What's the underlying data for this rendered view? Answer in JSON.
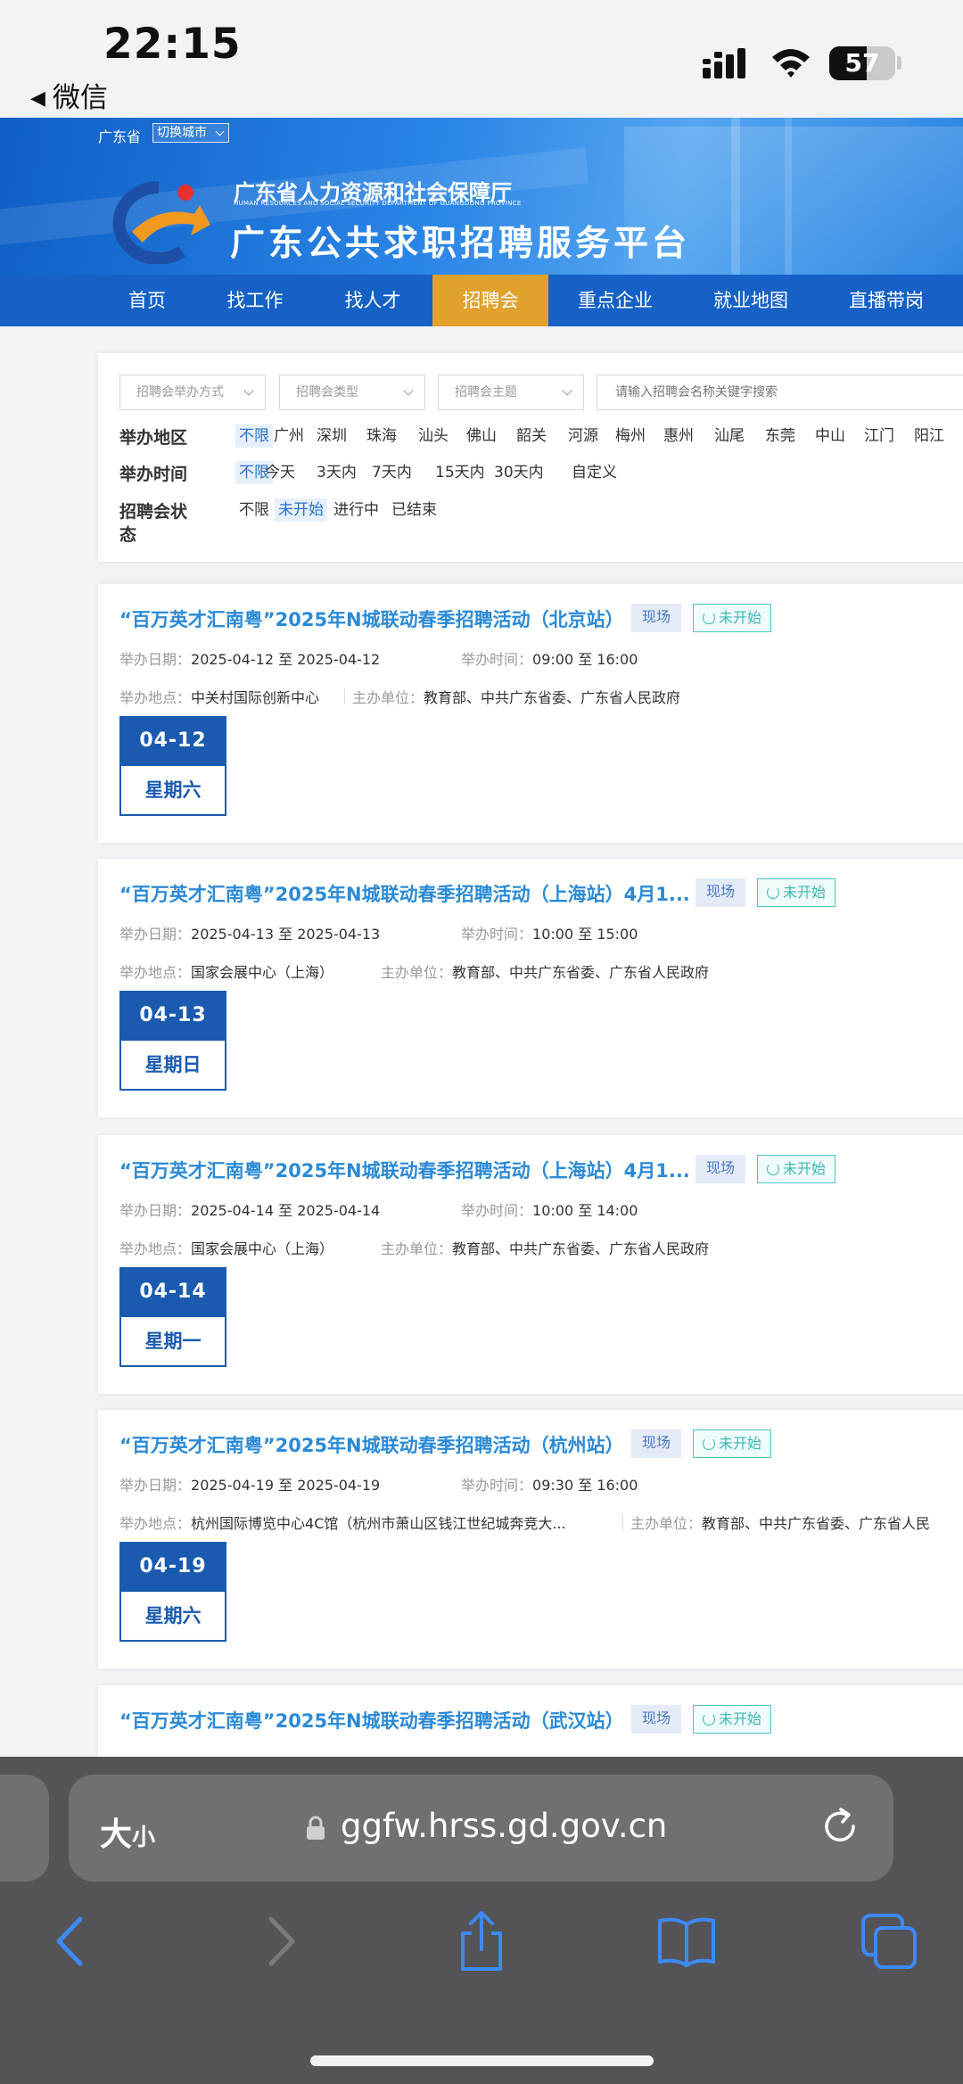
{
  "status_bar": {
    "time": "22:15",
    "back_label": "微信",
    "battery": "57",
    "battery_level": 0.57
  },
  "header": {
    "region": "广东省",
    "switch_city": "切换城市",
    "dept_cn": "广东省人力资源和社会保障厅",
    "dept_en": "HUMAN RESOURCES AND SOCIAL SECURITY DEPARTMENT OF GUANGDONG PROVINCE",
    "platform": "广东公共求职招聘服务平台"
  },
  "nav": [
    "首页",
    "找工作",
    "找人才",
    "招聘会",
    "重点企业",
    "就业地图",
    "直播带岗"
  ],
  "filters": {
    "selects": [
      "招聘会举办方式",
      "招聘会类型",
      "招聘会主题"
    ],
    "search_placeholder": "请输入招聘会名称关键字搜索",
    "area_label": "举办地区",
    "areas": [
      "不限",
      "广州",
      "深圳",
      "珠海",
      "汕头",
      "佛山",
      "韶关",
      "河源",
      "梅州",
      "惠州",
      "汕尾",
      "东莞",
      "中山",
      "江门",
      "阳江"
    ],
    "time_label": "举办时间",
    "times": [
      "不限",
      "今天",
      "3天内",
      "7天内",
      "15天内",
      "30天内",
      "自定义"
    ],
    "status_label_1": "招聘会状",
    "status_label_2": "态",
    "statuses": [
      "不限",
      "未开始",
      "进行中",
      "已结束"
    ]
  },
  "labels": {
    "date": "举办日期：",
    "time": "举办时间：",
    "place": "举办地点：",
    "host": "主办单位：",
    "to": "至"
  },
  "fairs": [
    {
      "title": "“百万英才汇南粤”2025年N城联动春季招聘活动（北京站）",
      "type": "现场",
      "status": "未开始",
      "start": "2025-04-12",
      "end": "2025-04-12",
      "time": "09:00 至 16:00",
      "place": "中关村国际创新中心",
      "host": "教育部、中共广东省委、广东省人民政府",
      "day": "04-12",
      "weekday": "星期六"
    },
    {
      "title": "“百万英才汇南粤”2025年N城联动春季招聘活动（上海站）4月1...",
      "type": "现场",
      "status": "未开始",
      "start": "2025-04-13",
      "end": "2025-04-13",
      "time": "10:00 至 15:00",
      "place": "国家会展中心（上海）",
      "host": "教育部、中共广东省委、广东省人民政府",
      "day": "04-13",
      "weekday": "星期日"
    },
    {
      "title": "“百万英才汇南粤”2025年N城联动春季招聘活动（上海站）4月1...",
      "type": "现场",
      "status": "未开始",
      "start": "2025-04-14",
      "end": "2025-04-14",
      "time": "10:00 至 14:00",
      "place": "国家会展中心（上海）",
      "host": "教育部、中共广东省委、广东省人民政府",
      "day": "04-14",
      "weekday": "星期一"
    },
    {
      "title": "“百万英才汇南粤”2025年N城联动春季招聘活动（杭州站）",
      "type": "现场",
      "status": "未开始",
      "start": "2025-04-19",
      "end": "2025-04-19",
      "time": "09:30 至 16:00",
      "place": "杭州国际博览中心4C馆（杭州市萧山区钱江世纪城奔竞大...",
      "host": "教育部、中共广东省委、广东省人民",
      "day": "04-19",
      "weekday": "星期六"
    },
    {
      "title": "“百万英才汇南粤”2025年N城联动春季招聘活动（武汉站）",
      "type": "现场",
      "status": "未开始"
    }
  ],
  "browser": {
    "size_label_big": "大",
    "size_label_small": "小",
    "url": "ggfw.hrss.gd.gov.cn"
  }
}
